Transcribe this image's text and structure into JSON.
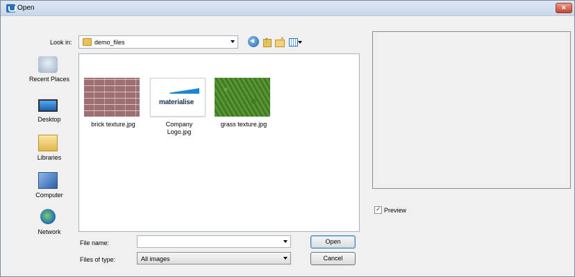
{
  "window": {
    "title": "Open"
  },
  "look_in": {
    "label": "Look in:",
    "value": "demo_files"
  },
  "toolbar": {
    "icons": [
      "back-icon",
      "up-folder-icon",
      "new-folder-icon",
      "views-menu-icon"
    ]
  },
  "places": [
    {
      "label": "Recent Places",
      "icon": "recent-places-icon"
    },
    {
      "label": "Desktop",
      "icon": "desktop-icon"
    },
    {
      "label": "Libraries",
      "icon": "libraries-icon"
    },
    {
      "label": "Computer",
      "icon": "computer-icon"
    },
    {
      "label": "Network",
      "icon": "network-icon"
    }
  ],
  "files": [
    {
      "name": "brick texture.jpg"
    },
    {
      "name": "Company Logo.jpg",
      "logo_text": "materialise"
    },
    {
      "name": "grass texture.jpg"
    }
  ],
  "preview": {
    "label": "Preview",
    "checked": true
  },
  "file_name": {
    "label": "File name:",
    "value": ""
  },
  "file_type": {
    "label": "Files of type:",
    "value": "All images"
  },
  "buttons": {
    "open": "Open",
    "cancel": "Cancel"
  }
}
